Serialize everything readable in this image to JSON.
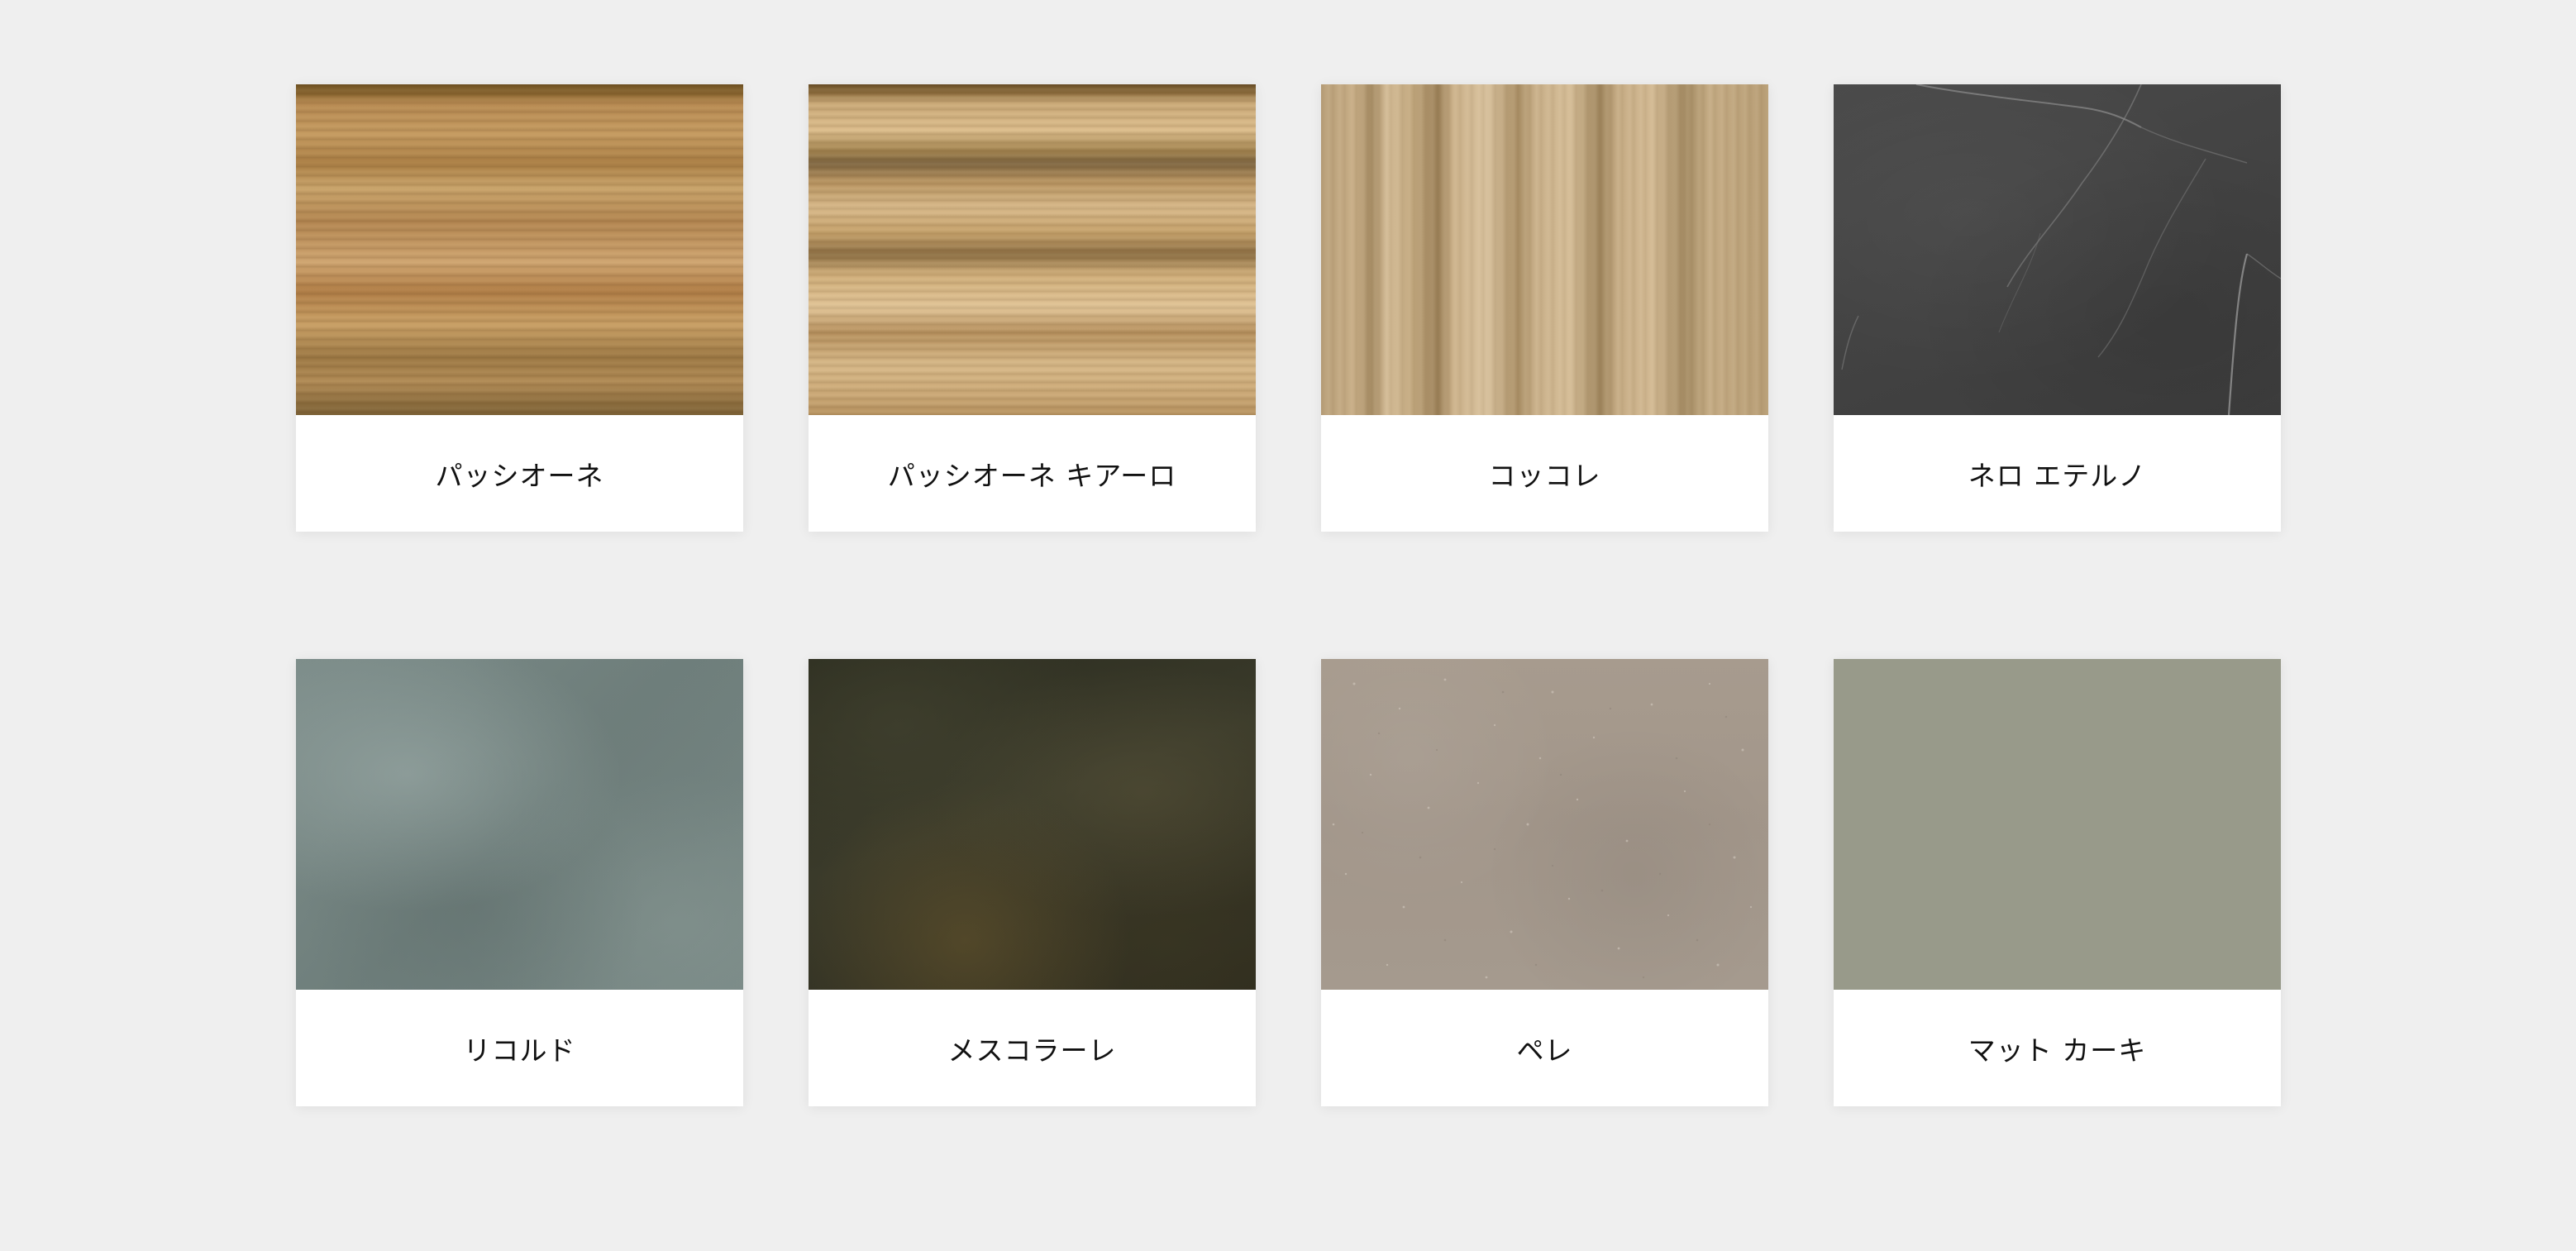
{
  "colors": {
    "page_background": "#efefef",
    "card_background": "#ffffff",
    "label_text": "#111111"
  },
  "materials": [
    {
      "label": "パッシオーネ",
      "icon": "wood-swatch",
      "swatch_color": "#b58a52"
    },
    {
      "label": "パッシオーネ キアーロ",
      "icon": "wood-swatch",
      "swatch_color": "#c9a877"
    },
    {
      "label": "コッコレ",
      "icon": "wood-swatch",
      "swatch_color": "#c2a87f"
    },
    {
      "label": "ネロ エテルノ",
      "icon": "marble-swatch",
      "swatch_color": "#434343"
    },
    {
      "label": "リコルド",
      "icon": "stone-swatch",
      "swatch_color": "#75858a"
    },
    {
      "label": "メスコラーレ",
      "icon": "stone-swatch",
      "swatch_color": "#33331f"
    },
    {
      "label": "ペレ",
      "icon": "stone-swatch",
      "swatch_color": "#a5998c"
    },
    {
      "label": "マット カーキ",
      "icon": "solid-swatch",
      "swatch_color": "#989a8a"
    }
  ]
}
